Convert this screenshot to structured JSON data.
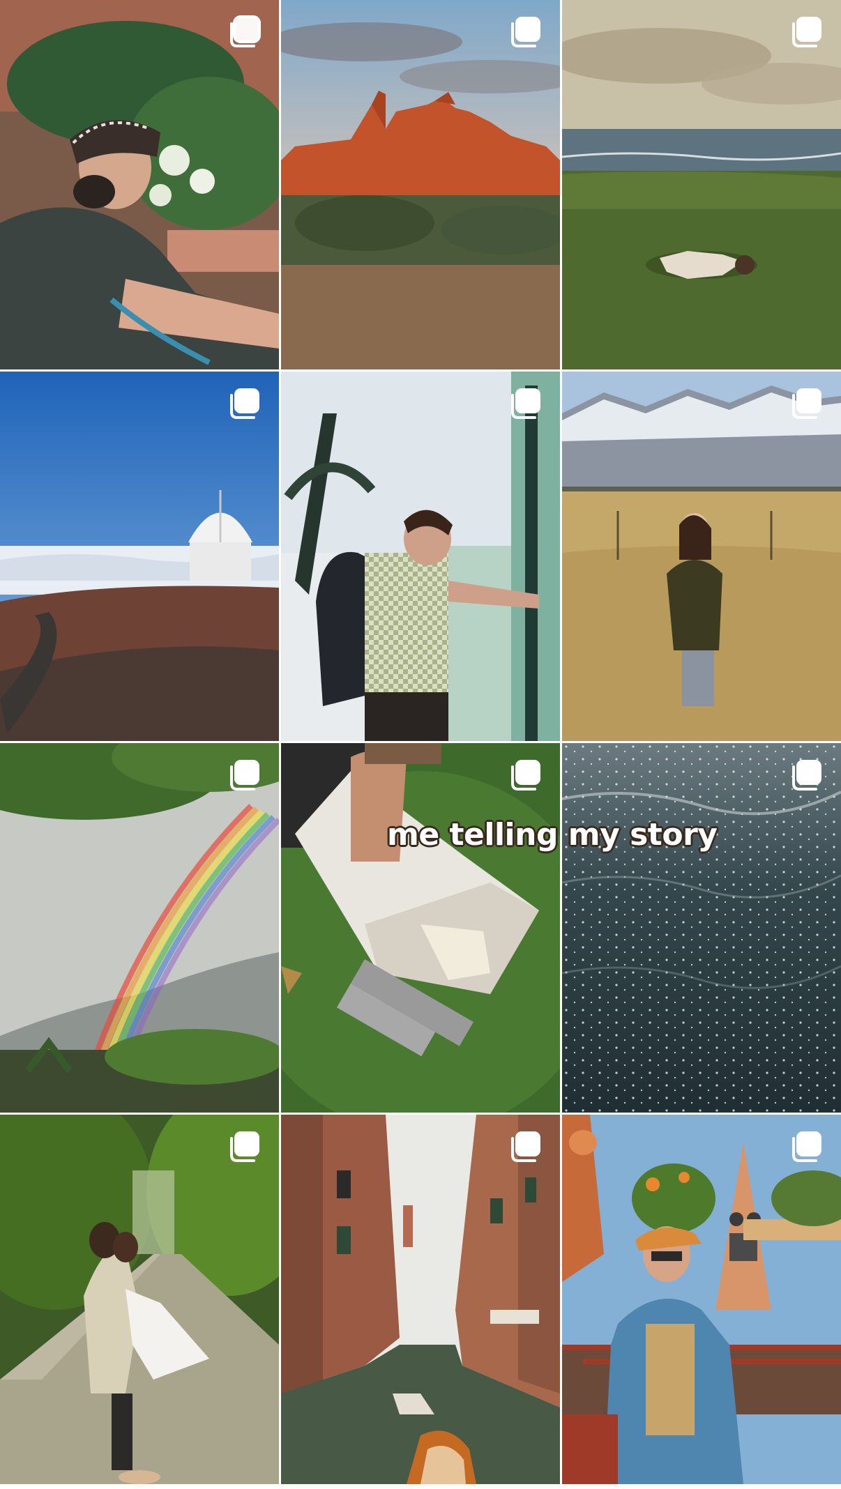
{
  "grid": {
    "tiles": [
      {
        "id": "hiker-bandana",
        "icon": "carousel-icon"
      },
      {
        "id": "red-rock-sunset",
        "icon": "carousel-icon"
      },
      {
        "id": "coastal-grass",
        "icon": "carousel-icon"
      },
      {
        "id": "observatory",
        "icon": "carousel-icon"
      },
      {
        "id": "backpacker-window",
        "icon": "carousel-icon"
      },
      {
        "id": "mountain-field",
        "icon": "carousel-icon"
      },
      {
        "id": "rainbow",
        "icon": "carousel-icon"
      },
      {
        "id": "cake-grass",
        "icon": "carousel-icon"
      },
      {
        "id": "sparkling-sea",
        "icon": "carousel-icon"
      },
      {
        "id": "couple-road",
        "icon": "carousel-icon"
      },
      {
        "id": "venice-canal",
        "icon": "carousel-icon"
      },
      {
        "id": "theme-park",
        "icon": "carousel-icon"
      }
    ]
  },
  "overlay": {
    "caption": "me telling my story"
  },
  "colors": {
    "icon_fill": "#ffffff",
    "caption_text": "#ffffff",
    "caption_outline": "#3a2a1e",
    "gap": "#ffffff"
  }
}
